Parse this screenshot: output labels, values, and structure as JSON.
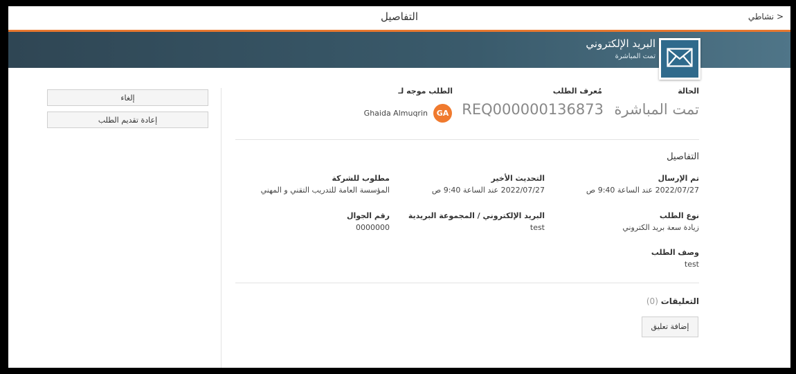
{
  "header": {
    "title": "التفاصيل",
    "back_label": "< نشاطي"
  },
  "banner": {
    "title": "البريد الإلكتروني",
    "subtitle": "تمت المباشرة"
  },
  "summary": {
    "status_label": "الحالة",
    "status_value": "تمت المباشرة",
    "request_id_label": "مُعرف الطلب",
    "request_id_value": "REQ000000136873",
    "assigned_label": "الطلب موجه لـ",
    "assignee_initials": "GA",
    "assignee_name": "Ghaida Almuqrin"
  },
  "actions": {
    "cancel": "إلغاء",
    "resubmit": "إعادة تقديم الطلب"
  },
  "details": {
    "heading": "التفاصيل",
    "submitted_label": "تم الإرسال",
    "submitted_value": "2022/07/27 عند الساعة 9:40 ص",
    "updated_label": "التحديث الأخير",
    "updated_value": "2022/07/27 عند الساعة 9:40 ص",
    "company_label": "مطلوب للشركة",
    "company_value": "المؤسسة العامة للتدريب التقني و المهني",
    "type_label": "نوع الطلب",
    "type_value": "زيادة سعة بريد الكتروني",
    "email_group_label": "البريد الإلكتروني / المجموعة البريدية",
    "email_group_value": "test",
    "mobile_label": "رقم الجوال",
    "mobile_value": "0000000",
    "description_label": "وصف الطلب",
    "description_value": "test"
  },
  "comments": {
    "label": "التعليقات",
    "count": "(0)",
    "add_button": "إضافة تعليق"
  },
  "colors": {
    "accent": "#e8772e",
    "banner": "#3a5b6c",
    "avatar": "#f07a2e",
    "tile": "#2f6a8c"
  },
  "icons": {
    "banner_icon": "envelope-icon"
  }
}
